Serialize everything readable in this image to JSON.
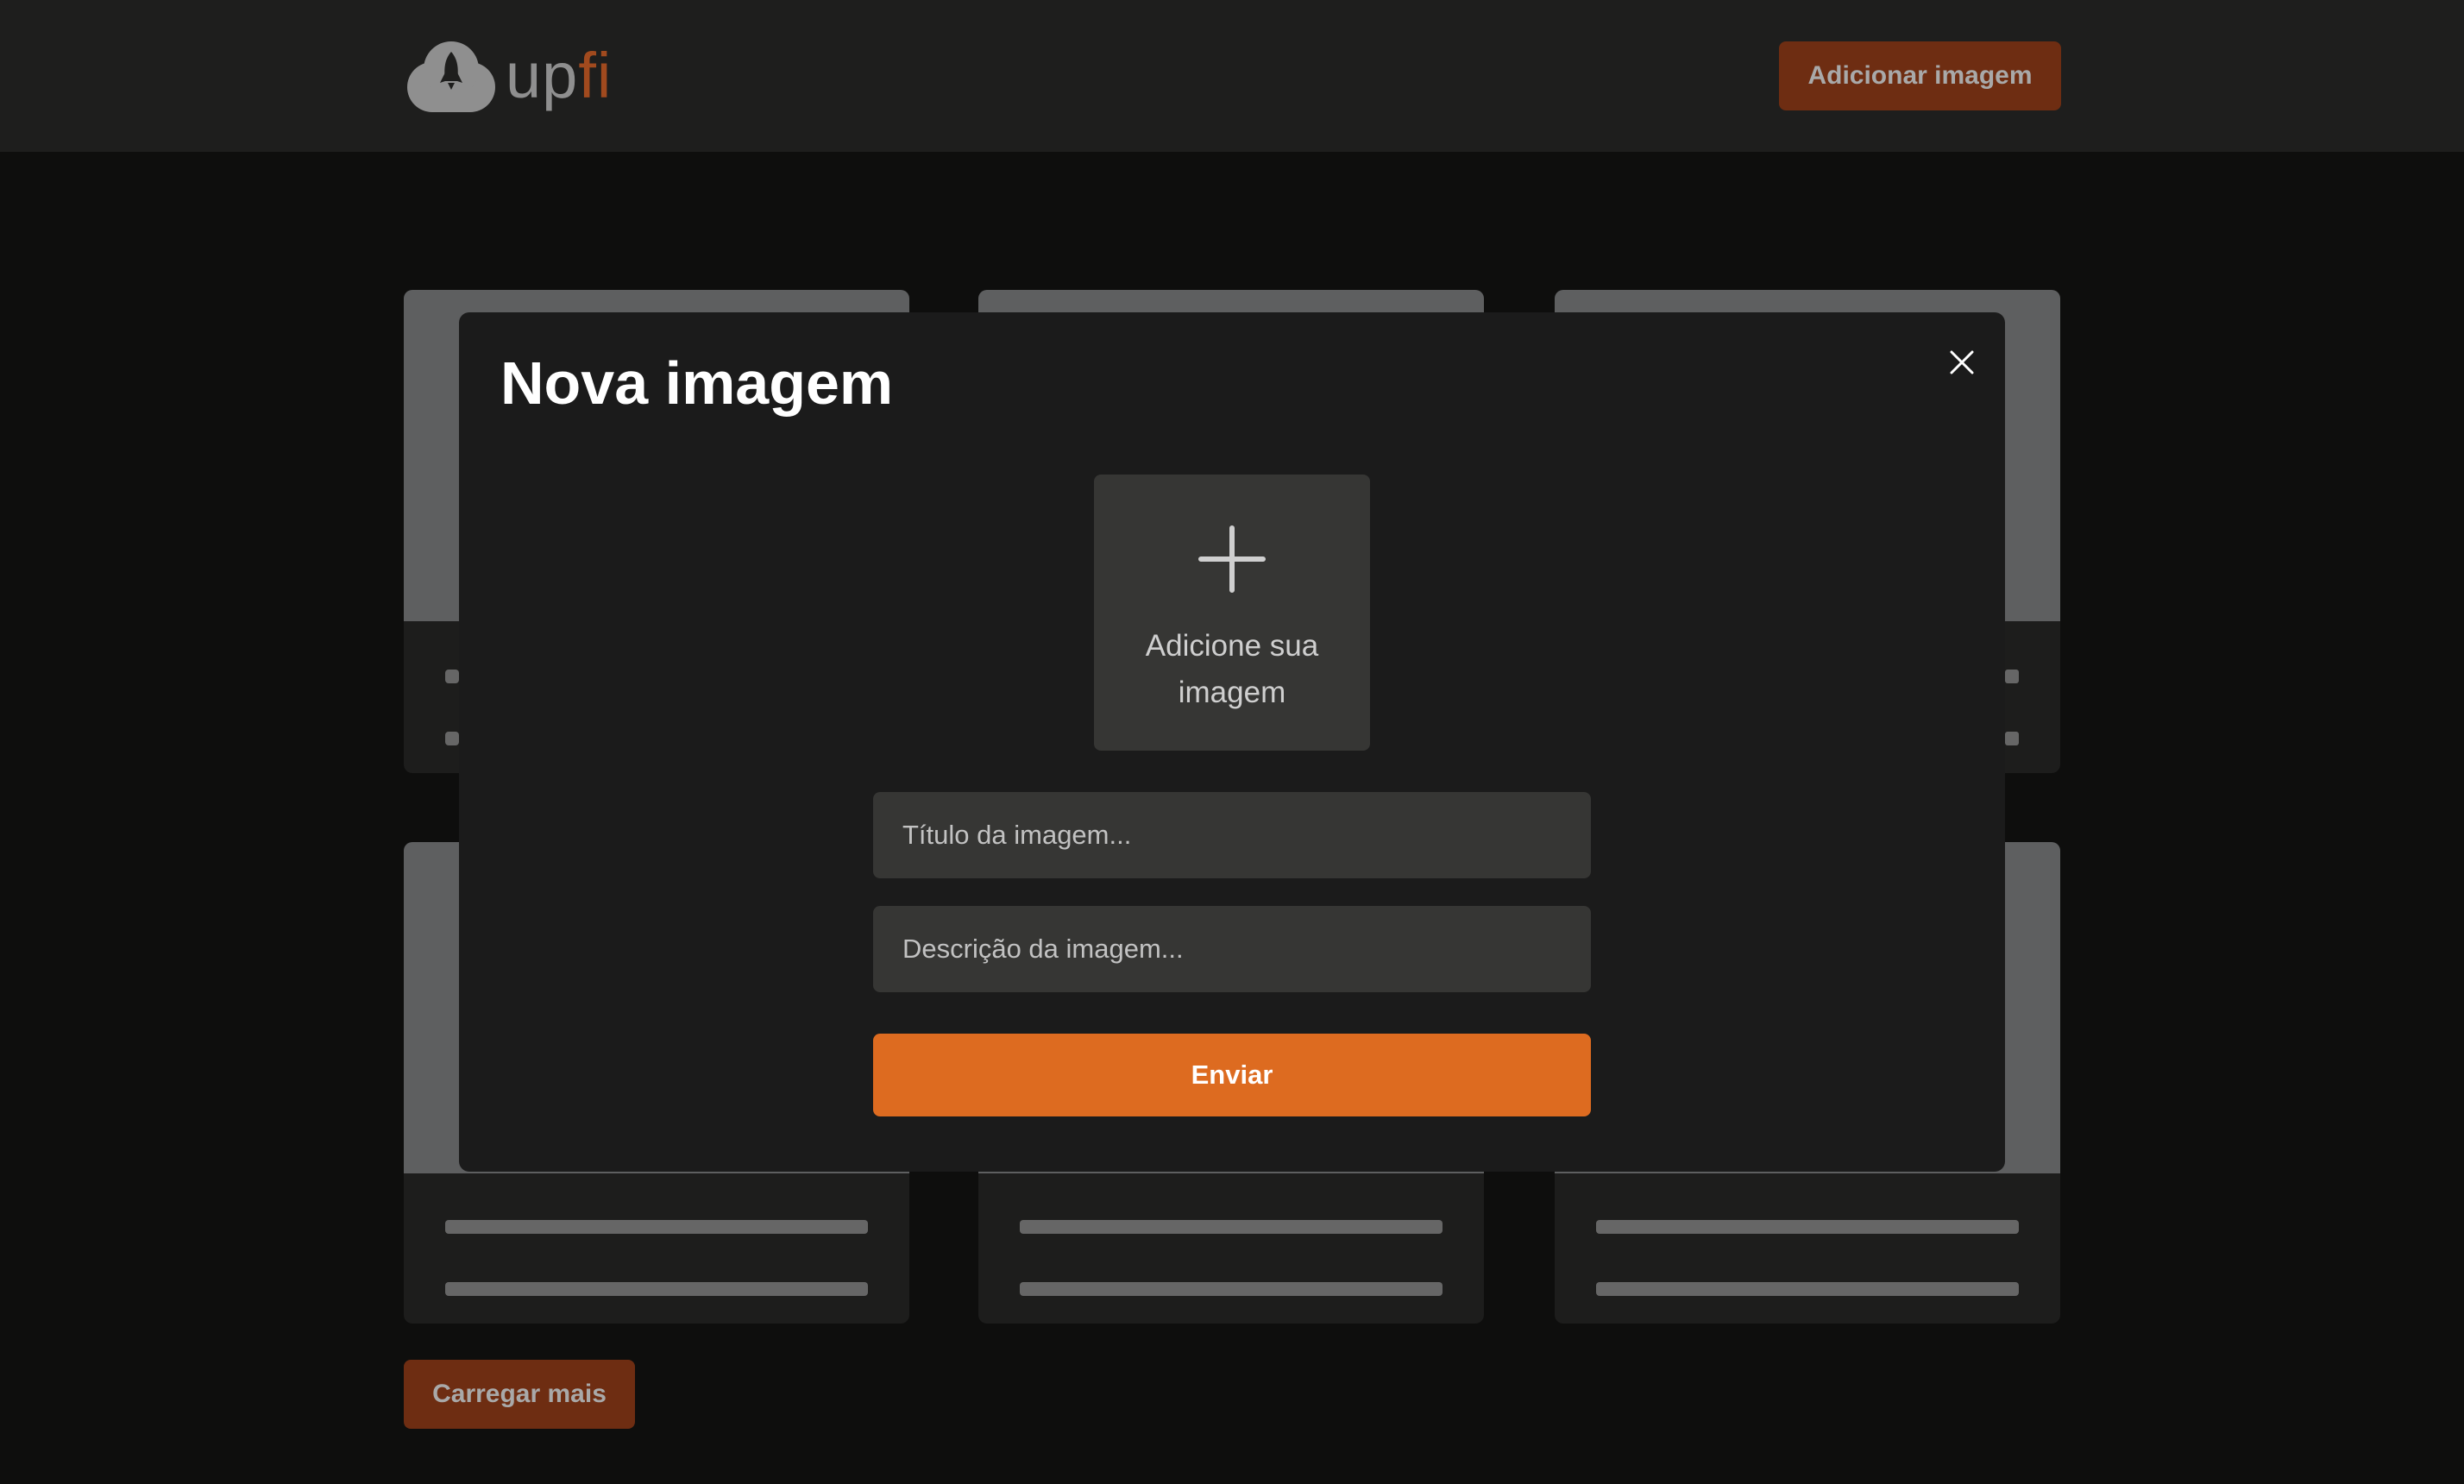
{
  "header": {
    "logo": {
      "text_up": "up",
      "text_fi": "fi",
      "icon": "cloud-rocket-icon"
    },
    "add_button_label": "Adicionar imagem"
  },
  "modal": {
    "title": "Nova imagem",
    "close_icon": "close-icon",
    "upload": {
      "icon": "plus-icon",
      "label": "Adicione sua imagem"
    },
    "title_field": {
      "placeholder": "Título da imagem...",
      "value": ""
    },
    "description_field": {
      "placeholder": "Descrição da imagem...",
      "value": ""
    },
    "submit_label": "Enviar"
  },
  "load_more_label": "Carregar mais",
  "colors": {
    "header_bg": "#1e1e1d",
    "page_bg": "#0e0e0d",
    "modal_bg": "#1b1b1b",
    "accent": "#dd6b20",
    "accent_dim": "#6e2d12",
    "field_bg": "#363634"
  }
}
